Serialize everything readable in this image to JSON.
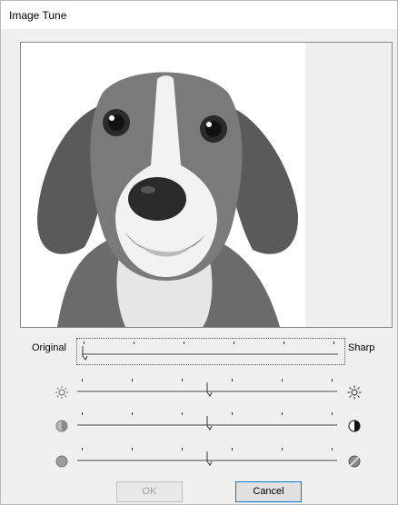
{
  "window": {
    "title": "Image Tune"
  },
  "sharpness": {
    "left_label": "Original",
    "right_label": "Sharp",
    "value_percent": 0
  },
  "sliders": [
    {
      "name": "brightness",
      "left_icon": "sun-dim-icon",
      "right_icon": "sun-bright-icon",
      "value_percent": 50
    },
    {
      "name": "contrast",
      "left_icon": "contrast-low-icon",
      "right_icon": "contrast-high-icon",
      "value_percent": 50
    },
    {
      "name": "saturation",
      "left_icon": "saturation-low-icon",
      "right_icon": "saturation-high-icon",
      "value_percent": 50
    }
  ],
  "buttons": {
    "ok": "OK",
    "cancel": "Cancel"
  },
  "colors": {
    "accent": "#0078d7",
    "track": "#9a9a9a"
  }
}
